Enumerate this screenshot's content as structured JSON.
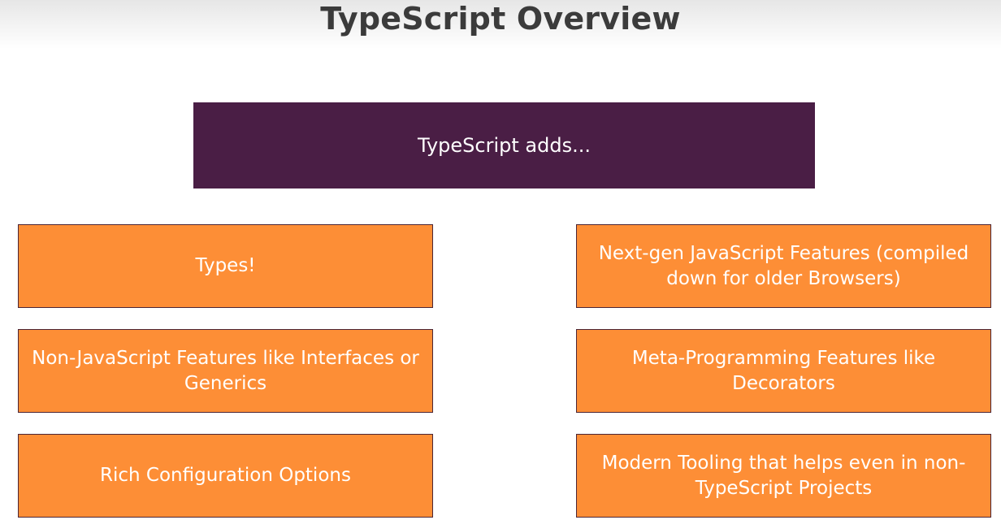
{
  "title": "TypeScript Overview",
  "header": {
    "label": "TypeScript adds..."
  },
  "features": [
    {
      "label": "Types!"
    },
    {
      "label": "Next-gen JavaScript Features (compiled down for older Browsers)"
    },
    {
      "label": "Non-JavaScript Features like Interfaces or Generics"
    },
    {
      "label": "Meta-Programming Features like Decorators"
    },
    {
      "label": "Rich Configuration Options"
    },
    {
      "label": "Modern Tooling that helps even in non-TypeScript Projects"
    }
  ],
  "colors": {
    "header_bg": "#4a1e45",
    "feature_bg": "#fd8e36",
    "feature_border": "#4b2535",
    "title_text": "#3b3b3b"
  }
}
